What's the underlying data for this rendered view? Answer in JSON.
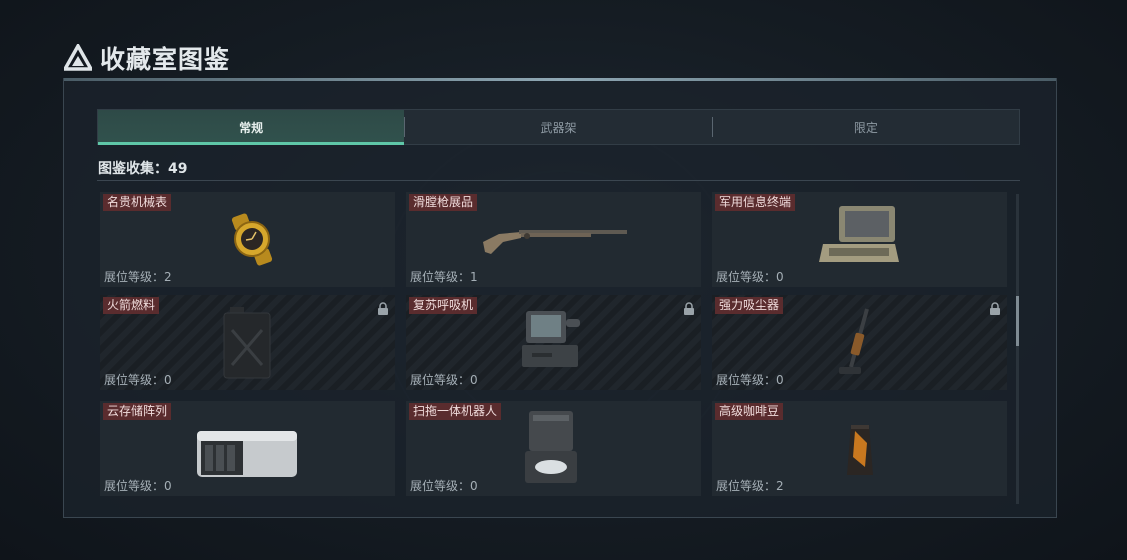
{
  "page": {
    "title": "收藏室图鉴"
  },
  "tabs": [
    {
      "label": "常规",
      "active": true
    },
    {
      "label": "武器架",
      "active": false
    },
    {
      "label": "限定",
      "active": false
    }
  ],
  "collection": {
    "label": "图鉴收集：",
    "count": "49"
  },
  "level_label": "展位等级：",
  "items": [
    {
      "name": "名贵机械表",
      "level": "2",
      "locked": false,
      "icon": "gold-watch-icon"
    },
    {
      "name": "滑膛枪展品",
      "level": "1",
      "locked": false,
      "icon": "musket-icon"
    },
    {
      "name": "军用信息终端",
      "level": "0",
      "locked": false,
      "icon": "military-terminal-icon"
    },
    {
      "name": "火箭燃料",
      "level": "0",
      "locked": true,
      "icon": "fuel-canister-icon"
    },
    {
      "name": "复苏呼吸机",
      "level": "0",
      "locked": true,
      "icon": "ventilator-icon"
    },
    {
      "name": "强力吸尘器",
      "level": "0",
      "locked": true,
      "icon": "vacuum-cleaner-icon"
    },
    {
      "name": "云存储阵列",
      "level": "0",
      "locked": false,
      "icon": "storage-array-icon"
    },
    {
      "name": "扫拖一体机器人",
      "level": "0",
      "locked": false,
      "icon": "mop-robot-icon"
    },
    {
      "name": "高级咖啡豆",
      "level": "2",
      "locked": false,
      "icon": "coffee-bag-icon"
    }
  ]
}
